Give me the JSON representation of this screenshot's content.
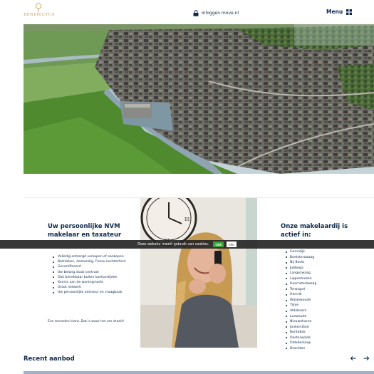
{
  "header": {
    "logo_text": "BENEDICTUS",
    "login_text": "Inloggen move.nl",
    "menu_label": "Menu",
    "icons": {
      "logo": "logo-icon",
      "login": "lock-icon",
      "menu": "grid-icon"
    }
  },
  "hero": {
    "image": "aerial-photo-residential-area-with-canals"
  },
  "intro": {
    "heading": "Uw persoonlijke NVM makelaar en taxateur",
    "items": [
      "Volledig ontzorgd verkopen of aankopen",
      "Betrokken, deskundig, Friese nuchterheid",
      "Gecertificeerd",
      "Uw belang staat centraal",
      "Ook bereikbaar buiten kantoortijden",
      "Kennis van de woningmarkt",
      "Groot netwerk",
      "Uw persoonlijke adviseur en vraagbaak"
    ],
    "footnote": "Een tevreden klant. Dat is waar het om draait!"
  },
  "portrait": {
    "image": "photo-woman-on-phone-with-wall-clock"
  },
  "areas": {
    "heading": "Onze makelaardij is actief in:",
    "items": [
      "Gorredijk",
      "Beetsterzwaag",
      "Nij Beets",
      "Jubbega",
      "Langezwaag",
      "Lippenhuizen",
      "Hoornsterzwaag",
      "Terwispel",
      "Hemrik",
      "Wijnjewoude",
      "Tijnje",
      "Aldeboarn",
      "Luxwoude",
      "Nieuwehorne",
      "Jonkerslând",
      "Bontebok",
      "Oosterwolde",
      "Oldeberkoop",
      "Drachten"
    ]
  },
  "cookie": {
    "text": "Deze website maakt gebruik van cookies.",
    "ok_label": "Oké",
    "info_label": "Info"
  },
  "recent": {
    "title": "Recent aanbod",
    "prev_icon": "arrow-left-icon",
    "next_icon": "arrow-right-icon"
  },
  "colors": {
    "navy": "#0f2a4d",
    "gold": "#c8a25a",
    "cookie_bg": "#262626",
    "ok_green": "#36a23a"
  }
}
